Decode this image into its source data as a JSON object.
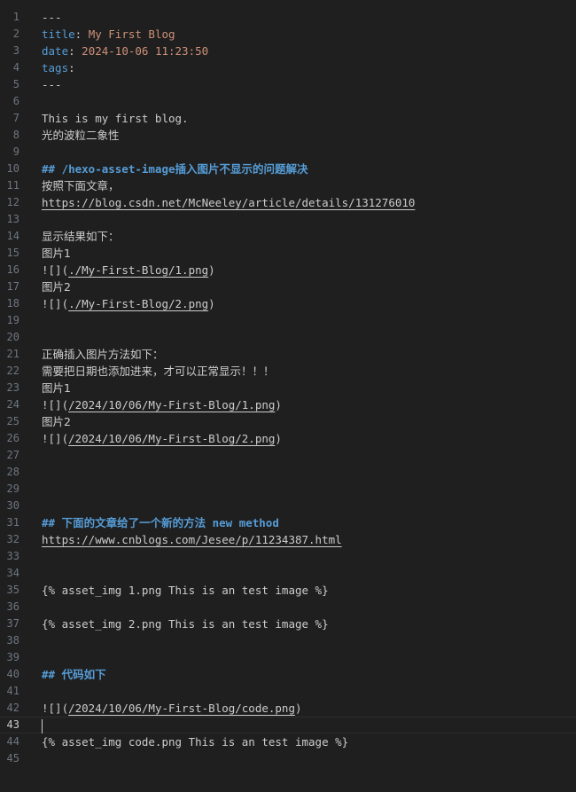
{
  "editor": {
    "lines": [
      {
        "n": "1",
        "segments": [
          {
            "t": "---",
            "c": "punct"
          }
        ]
      },
      {
        "n": "2",
        "segments": [
          {
            "t": "title",
            "c": "key"
          },
          {
            "t": ": ",
            "c": "punct"
          },
          {
            "t": "My First Blog",
            "c": "str"
          }
        ]
      },
      {
        "n": "3",
        "segments": [
          {
            "t": "date",
            "c": "key"
          },
          {
            "t": ": ",
            "c": "punct"
          },
          {
            "t": "2024-10-06 11:23:50",
            "c": "str"
          }
        ]
      },
      {
        "n": "4",
        "segments": [
          {
            "t": "tags",
            "c": "key"
          },
          {
            "t": ":",
            "c": "punct"
          }
        ]
      },
      {
        "n": "5",
        "segments": [
          {
            "t": "---",
            "c": "punct"
          }
        ]
      },
      {
        "n": "6",
        "segments": []
      },
      {
        "n": "7",
        "segments": [
          {
            "t": "This is my first blog.",
            "c": "punct"
          }
        ]
      },
      {
        "n": "8",
        "segments": [
          {
            "t": "光的波粒二象性",
            "c": "cjk"
          }
        ]
      },
      {
        "n": "9",
        "segments": []
      },
      {
        "n": "10",
        "segments": [
          {
            "t": "## /hexo-asset-image插入图片不显示的问题解决",
            "c": "head"
          }
        ]
      },
      {
        "n": "11",
        "segments": [
          {
            "t": "按照下面文章，",
            "c": "cjk"
          }
        ]
      },
      {
        "n": "12",
        "segments": [
          {
            "t": "https://blog.csdn.net/McNeeley/article/details/131276010",
            "c": "link"
          }
        ]
      },
      {
        "n": "13",
        "segments": []
      },
      {
        "n": "14",
        "segments": [
          {
            "t": "显示结果如下：",
            "c": "cjk"
          }
        ]
      },
      {
        "n": "15",
        "segments": [
          {
            "t": "图片1",
            "c": "cjk"
          }
        ]
      },
      {
        "n": "16",
        "segments": [
          {
            "t": "![](",
            "c": "punct"
          },
          {
            "t": "./My-First-Blog/1.png",
            "c": "link"
          },
          {
            "t": ")",
            "c": "punct"
          }
        ]
      },
      {
        "n": "17",
        "segments": [
          {
            "t": "图片2",
            "c": "cjk"
          }
        ]
      },
      {
        "n": "18",
        "segments": [
          {
            "t": "![](",
            "c": "punct"
          },
          {
            "t": "./My-First-Blog/2.png",
            "c": "link"
          },
          {
            "t": ")",
            "c": "punct"
          }
        ]
      },
      {
        "n": "19",
        "segments": []
      },
      {
        "n": "20",
        "segments": []
      },
      {
        "n": "21",
        "segments": [
          {
            "t": "正确插入图片方法如下：",
            "c": "cjk"
          }
        ]
      },
      {
        "n": "22",
        "segments": [
          {
            "t": "需要把日期也添加进来，才可以正常显示！！！",
            "c": "cjk"
          }
        ]
      },
      {
        "n": "23",
        "segments": [
          {
            "t": "图片1",
            "c": "cjk"
          }
        ]
      },
      {
        "n": "24",
        "segments": [
          {
            "t": "![](",
            "c": "punct"
          },
          {
            "t": "/2024/10/06/My-First-Blog/1.png",
            "c": "link"
          },
          {
            "t": ")",
            "c": "punct"
          }
        ]
      },
      {
        "n": "25",
        "segments": [
          {
            "t": "图片2",
            "c": "cjk"
          }
        ]
      },
      {
        "n": "26",
        "segments": [
          {
            "t": "![](",
            "c": "punct"
          },
          {
            "t": "/2024/10/06/My-First-Blog/2.png",
            "c": "link"
          },
          {
            "t": ")",
            "c": "punct"
          }
        ]
      },
      {
        "n": "27",
        "segments": []
      },
      {
        "n": "28",
        "segments": []
      },
      {
        "n": "29",
        "segments": []
      },
      {
        "n": "30",
        "segments": []
      },
      {
        "n": "31",
        "segments": [
          {
            "t": "## 下面的文章给了一个新的方法 new method",
            "c": "head"
          }
        ]
      },
      {
        "n": "32",
        "segments": [
          {
            "t": "https://www.cnblogs.com/Jesee/p/11234387.html",
            "c": "link"
          }
        ]
      },
      {
        "n": "33",
        "segments": []
      },
      {
        "n": "34",
        "segments": []
      },
      {
        "n": "35",
        "segments": [
          {
            "t": "{% asset_img 1.png This is an test image %}",
            "c": "punct"
          }
        ]
      },
      {
        "n": "36",
        "segments": []
      },
      {
        "n": "37",
        "segments": [
          {
            "t": "{% asset_img 2.png This is an test image %}",
            "c": "punct"
          }
        ]
      },
      {
        "n": "38",
        "segments": []
      },
      {
        "n": "39",
        "segments": []
      },
      {
        "n": "40",
        "segments": [
          {
            "t": "## 代码如下",
            "c": "head"
          }
        ]
      },
      {
        "n": "41",
        "segments": []
      },
      {
        "n": "42",
        "segments": [
          {
            "t": "![](",
            "c": "punct"
          },
          {
            "t": "/2024/10/06/My-First-Blog/code.png",
            "c": "link"
          },
          {
            "t": ")",
            "c": "punct"
          }
        ]
      },
      {
        "n": "43",
        "current": true,
        "segments": []
      },
      {
        "n": "44",
        "segments": [
          {
            "t": "{% asset_img code.png This is an test image %}",
            "c": "punct"
          }
        ]
      },
      {
        "n": "45",
        "segments": []
      }
    ]
  },
  "colors": {
    "background": "#1f1f1f",
    "text": "#cccccc",
    "key": "#569cd6",
    "string": "#ce9178",
    "heading": "#569cd6",
    "gutter": "#6e7681"
  }
}
